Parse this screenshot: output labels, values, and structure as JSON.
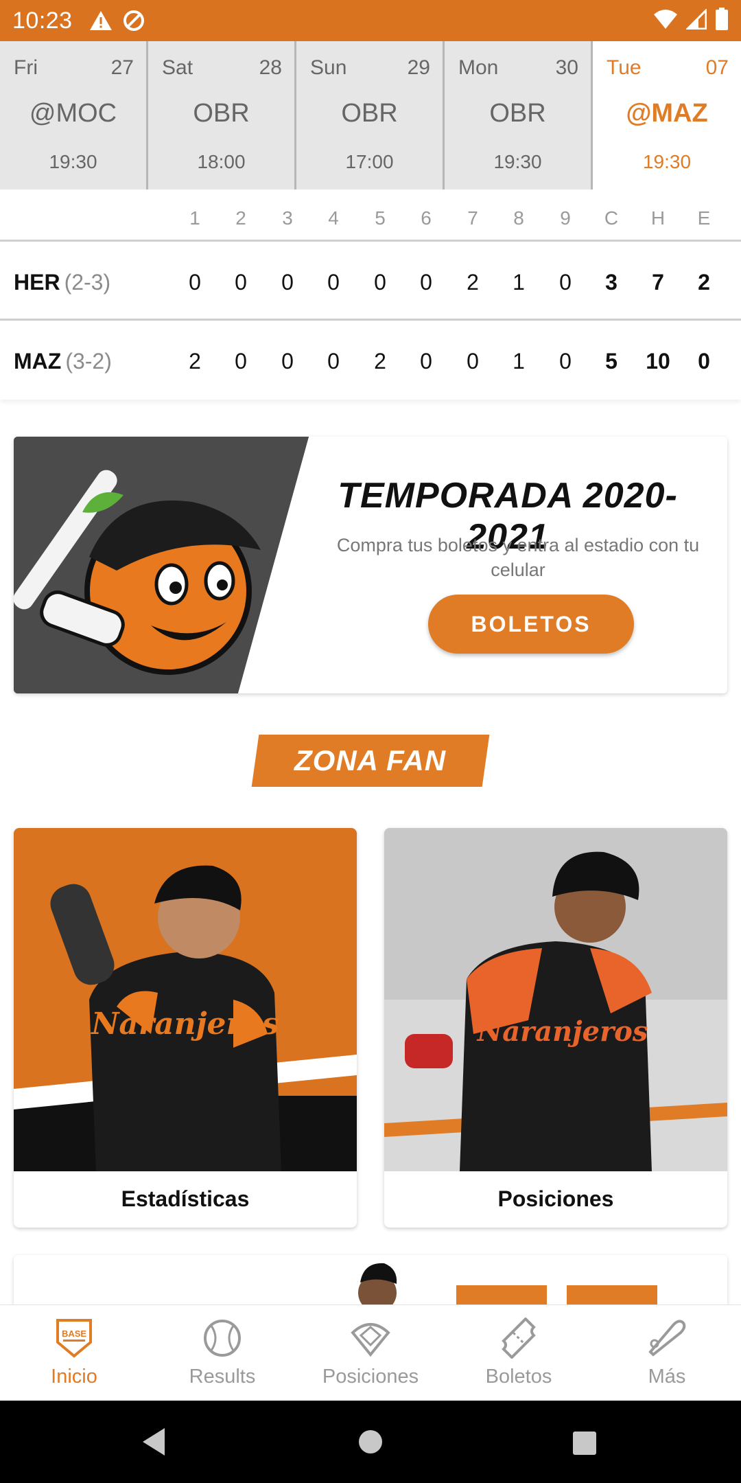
{
  "status_bar": {
    "time": "10:23",
    "icons": [
      "warning-icon",
      "no-sync-icon",
      "wifi-icon",
      "cell-signal-icon",
      "battery-icon"
    ]
  },
  "schedule": [
    {
      "dow": "Fri",
      "day": "27",
      "opponent": "@MOC",
      "time": "19:30",
      "selected": false
    },
    {
      "dow": "Sat",
      "day": "28",
      "opponent": "OBR",
      "time": "18:00",
      "selected": false
    },
    {
      "dow": "Sun",
      "day": "29",
      "opponent": "OBR",
      "time": "17:00",
      "selected": false
    },
    {
      "dow": "Mon",
      "day": "30",
      "opponent": "OBR",
      "time": "19:30",
      "selected": false
    },
    {
      "dow": "Tue",
      "day": "07",
      "opponent": "@MAZ",
      "time": "19:30",
      "selected": true
    }
  ],
  "boxscore": {
    "headers": [
      "1",
      "2",
      "3",
      "4",
      "5",
      "6",
      "7",
      "8",
      "9",
      "C",
      "H",
      "E"
    ],
    "teams": [
      {
        "name": "HER",
        "record": "(2-3)",
        "innings": [
          "0",
          "0",
          "0",
          "0",
          "0",
          "0",
          "2",
          "1",
          "0"
        ],
        "totals": [
          "3",
          "7",
          "2"
        ]
      },
      {
        "name": "MAZ",
        "record": "(3-2)",
        "innings": [
          "2",
          "0",
          "0",
          "0",
          "2",
          "0",
          "0",
          "1",
          "0"
        ],
        "totals": [
          "5",
          "10",
          "0"
        ]
      }
    ]
  },
  "promo": {
    "title": "TEMPORADA 2020-2021",
    "subtitle": "Compra tus boletos y entra al estadio con tu celular",
    "button": "BOLETOS"
  },
  "zona_fan": "ZONA FAN",
  "fan_cards": [
    {
      "label": "Estadísticas"
    },
    {
      "label": "Posiciones"
    }
  ],
  "bottom_nav": [
    {
      "label": "Inicio",
      "icon": "home-plate-icon",
      "active": true
    },
    {
      "label": "Results",
      "icon": "baseball-icon",
      "active": false
    },
    {
      "label": "Posiciones",
      "icon": "diamond-icon",
      "active": false
    },
    {
      "label": "Boletos",
      "icon": "ticket-icon",
      "active": false
    },
    {
      "label": "Más",
      "icon": "bat-icon",
      "active": false
    }
  ],
  "colors": {
    "accent": "#e07b26",
    "status_bar": "#d9731f",
    "inactive": "#9a9a9a"
  }
}
